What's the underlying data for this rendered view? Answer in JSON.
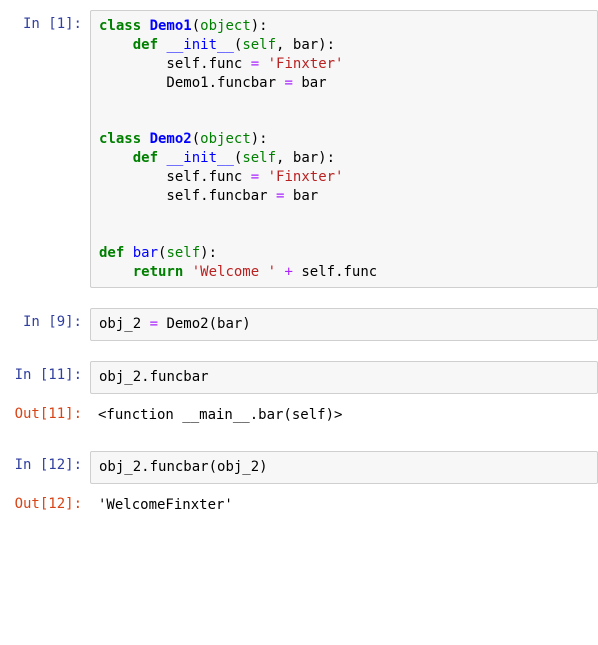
{
  "cells": [
    {
      "type": "in",
      "n": 1,
      "prompt": "In [1]:",
      "tokens": [
        {
          "t": "class ",
          "c": "kw"
        },
        {
          "t": "Demo1",
          "c": "cls"
        },
        {
          "t": "("
        },
        {
          "t": "object",
          "c": "builtin"
        },
        {
          "t": "):"
        },
        {
          "t": "\n"
        },
        {
          "t": "    "
        },
        {
          "t": "def ",
          "c": "kw"
        },
        {
          "t": "__init__",
          "c": "fn"
        },
        {
          "t": "("
        },
        {
          "t": "self",
          "c": "self"
        },
        {
          "t": ", bar):"
        },
        {
          "t": "\n"
        },
        {
          "t": "        self"
        },
        {
          "t": "."
        },
        {
          "t": "func "
        },
        {
          "t": "=",
          "c": "op"
        },
        {
          "t": " "
        },
        {
          "t": "'Finxter'",
          "c": "str"
        },
        {
          "t": "\n"
        },
        {
          "t": "        Demo1"
        },
        {
          "t": "."
        },
        {
          "t": "funcbar "
        },
        {
          "t": "=",
          "c": "op"
        },
        {
          "t": " bar"
        },
        {
          "t": "\n"
        },
        {
          "t": "\n"
        },
        {
          "t": "\n"
        },
        {
          "t": "class ",
          "c": "kw"
        },
        {
          "t": "Demo2",
          "c": "cls"
        },
        {
          "t": "("
        },
        {
          "t": "object",
          "c": "builtin"
        },
        {
          "t": "):"
        },
        {
          "t": "\n"
        },
        {
          "t": "    "
        },
        {
          "t": "def ",
          "c": "kw"
        },
        {
          "t": "__init__",
          "c": "fn"
        },
        {
          "t": "("
        },
        {
          "t": "self",
          "c": "self"
        },
        {
          "t": ", bar):"
        },
        {
          "t": "\n"
        },
        {
          "t": "        self"
        },
        {
          "t": "."
        },
        {
          "t": "func "
        },
        {
          "t": "=",
          "c": "op"
        },
        {
          "t": " "
        },
        {
          "t": "'Finxter'",
          "c": "str"
        },
        {
          "t": "\n"
        },
        {
          "t": "        self"
        },
        {
          "t": "."
        },
        {
          "t": "funcbar "
        },
        {
          "t": "=",
          "c": "op"
        },
        {
          "t": " bar"
        },
        {
          "t": "\n"
        },
        {
          "t": "\n"
        },
        {
          "t": "\n"
        },
        {
          "t": "def ",
          "c": "kw"
        },
        {
          "t": "bar",
          "c": "fn"
        },
        {
          "t": "("
        },
        {
          "t": "self",
          "c": "self"
        },
        {
          "t": "):"
        },
        {
          "t": "\n"
        },
        {
          "t": "    "
        },
        {
          "t": "return ",
          "c": "kw"
        },
        {
          "t": "'Welcome '",
          "c": "str"
        },
        {
          "t": " "
        },
        {
          "t": "+",
          "c": "op"
        },
        {
          "t": " self"
        },
        {
          "t": "."
        },
        {
          "t": "func"
        }
      ]
    },
    {
      "type": "in",
      "n": 9,
      "prompt": "In [9]:",
      "tokens": [
        {
          "t": "obj_2 "
        },
        {
          "t": "=",
          "c": "op"
        },
        {
          "t": " Demo2(bar)"
        }
      ]
    },
    {
      "type": "in",
      "n": 11,
      "prompt": "In [11]:",
      "tokens": [
        {
          "t": "obj_2"
        },
        {
          "t": "."
        },
        {
          "t": "funcbar"
        }
      ]
    },
    {
      "type": "out",
      "n": 11,
      "prompt": "Out[11]:",
      "text": "<function __main__.bar(self)>"
    },
    {
      "type": "in",
      "n": 12,
      "prompt": "In [12]:",
      "tokens": [
        {
          "t": "obj_2"
        },
        {
          "t": "."
        },
        {
          "t": "funcbar(obj_2)"
        }
      ]
    },
    {
      "type": "out",
      "n": 12,
      "prompt": "Out[12]:",
      "text": "'WelcomeFinxter'"
    }
  ]
}
